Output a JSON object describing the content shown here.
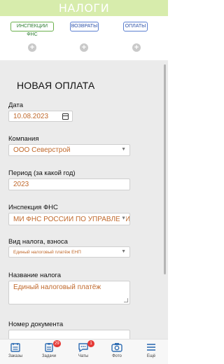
{
  "header": {
    "title": "НАЛОГИ"
  },
  "chips": [
    {
      "label": "ИНСПЕКЦИИ ФНС"
    },
    {
      "label": "ВОЗВРАТЫ"
    },
    {
      "label": "ОПЛАТЫ"
    }
  ],
  "form": {
    "title": "НОВАЯ ОПЛАТА",
    "date": {
      "label": "Дата",
      "value": "10.08.2023"
    },
    "company": {
      "label": "Компания",
      "value": "ООО Северстрой"
    },
    "period": {
      "label": "Период (за какой год)",
      "value": "2023"
    },
    "inspection": {
      "label": "Инспекция ФНС",
      "value": "МИ ФНС РОССИИ ПО УПРАВЛЕНИ"
    },
    "tax_type": {
      "label": "Вид налога, взноса",
      "value": "Единый налоговый платёж ЕНП"
    },
    "tax_name": {
      "label": "Название налога",
      "value": "Единый налоговый платёж"
    },
    "doc_number": {
      "label": "Номер документа"
    }
  },
  "nav": [
    {
      "label": "Заказы",
      "icon": "orders-icon"
    },
    {
      "label": "Задачи",
      "icon": "tasks-icon",
      "badge": "29"
    },
    {
      "label": "Чаты",
      "icon": "chat-icon",
      "badge": "1"
    },
    {
      "label": "Фото",
      "icon": "camera-icon"
    },
    {
      "label": "Ещё",
      "icon": "menu-icon"
    }
  ],
  "colors": {
    "header_bg": "#d7ecac",
    "accent_green": "#6ab04c",
    "accent_blue": "#5b7fd0",
    "value_text": "#c0692c",
    "badge": "#e53935"
  }
}
